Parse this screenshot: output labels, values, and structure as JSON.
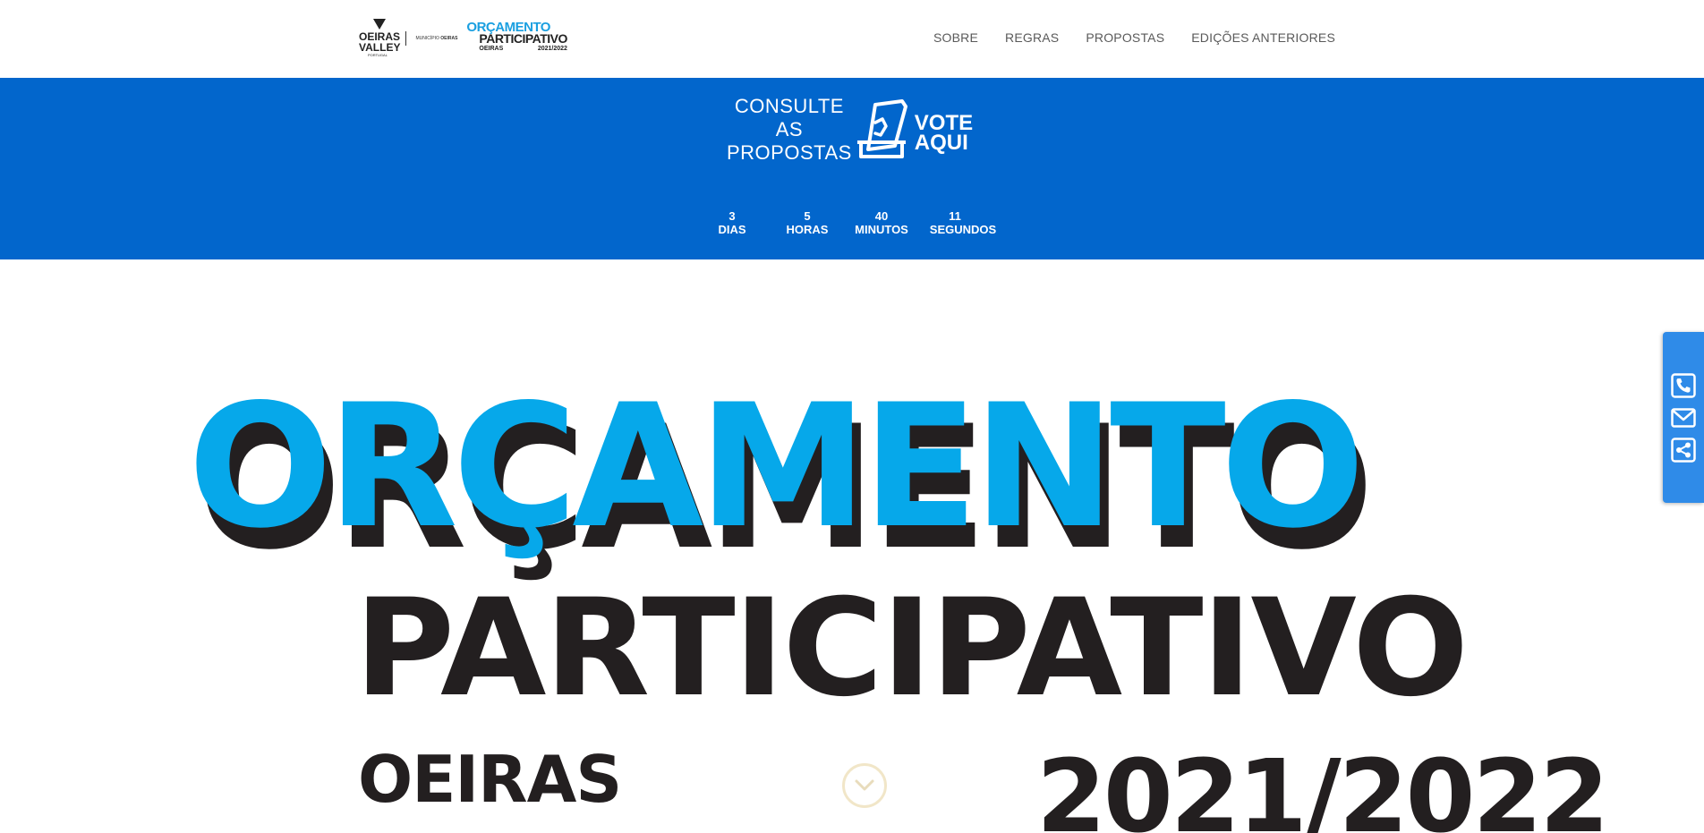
{
  "header": {
    "logo": {
      "oeiras_line1": "OEIRAS",
      "oeiras_line2": "VALLEY",
      "oeiras_tiny": "PORTUGAL",
      "municipio_prefix": "MUNICÍPIO",
      "municipio_name": "OEIRAS",
      "op_line1": "ORÇAMENTO",
      "op_line2": "PARTICIPATIVO",
      "op_city": "OEIRAS",
      "op_year": "2021/2022"
    },
    "nav": [
      "SOBRE",
      "REGRAS",
      "PROPOSTAS",
      "EDIÇÕES ANTERIORES"
    ]
  },
  "banner": {
    "consulte": [
      "CONSULTE",
      "AS",
      "PROPOSTAS"
    ],
    "vote": [
      "VOTE",
      "AQUI"
    ],
    "icon": "ballot-box-icon",
    "background_color": "#0266cc"
  },
  "countdown": [
    {
      "value": "3",
      "unit": "DIAS"
    },
    {
      "value": "5",
      "unit": "HORAS"
    },
    {
      "value": "40",
      "unit": "MINUTOS"
    },
    {
      "value": "11",
      "unit": "SEGUNDOS"
    }
  ],
  "hero": {
    "title_line1": "ORÇAMENTO",
    "title_line2": "PARTICIPATIVO",
    "city": "OEIRAS",
    "year": "2021/2022",
    "title_color": "#06a8ea",
    "text_color": "#231f20",
    "scroll_icon": "chevron-down-icon"
  },
  "side_contact": {
    "icons": [
      "phone-icon",
      "envelope-icon",
      "share-icon"
    ],
    "background_color": "#2f8be8"
  }
}
